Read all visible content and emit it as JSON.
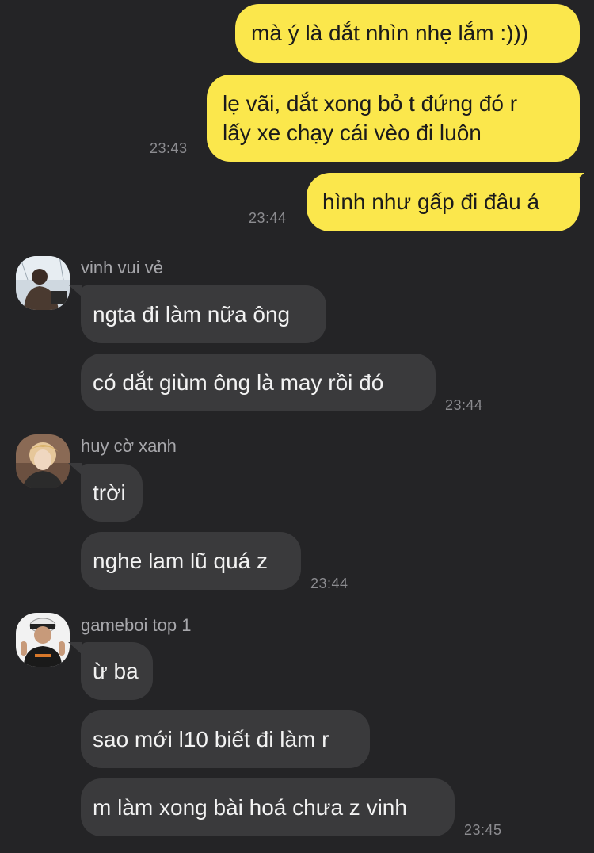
{
  "colors": {
    "background": "#242426",
    "outgoing_bubble": "#fbe74c",
    "incoming_bubble": "#3a3a3c",
    "timestamp": "#8c8c90"
  },
  "messages_out": [
    {
      "text": "mà ý là dắt nhìn nhẹ lắm :)))"
    },
    {
      "line1": "lẹ vãi, dắt xong bỏ t đứng đó r",
      "line2": "lấy xe chạy cái vèo đi luôn",
      "time": "23:43"
    },
    {
      "text": "hình như gấp đi đâu á",
      "time": "23:44"
    }
  ],
  "groups": [
    {
      "sender": "vinh vui vẻ",
      "avatar_icon": "profile-photo-icon",
      "messages": [
        "ngta đi làm nữa ông",
        "có dắt giùm ông là may rồi đó"
      ],
      "time": "23:44"
    },
    {
      "sender": "huy cờ xanh",
      "avatar_icon": "profile-photo-icon",
      "messages": [
        "trời",
        "nghe lam lũ quá z"
      ],
      "time": "23:44"
    },
    {
      "sender": "gameboi top 1",
      "avatar_icon": "profile-photo-icon",
      "messages": [
        "ừ ba",
        "sao mới l10 biết đi làm r",
        "m làm xong bài hoá chưa z vinh"
      ],
      "time": "23:45"
    }
  ]
}
